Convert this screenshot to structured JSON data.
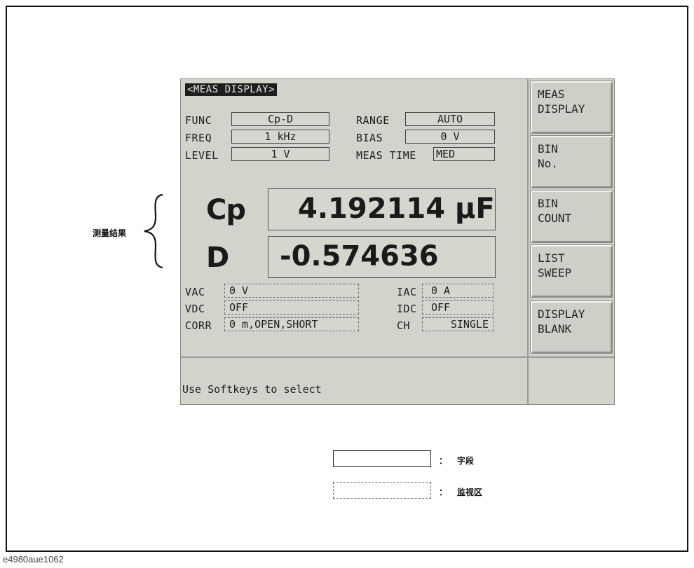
{
  "screen": {
    "title": "<MEAS DISPLAY>",
    "settings": {
      "func_label": "FUNC",
      "func_value": "Cp-D",
      "freq_label": "FREQ",
      "freq_value": "1 kHz",
      "level_label": "LEVEL",
      "level_value": "1 V",
      "range_label": "RANGE",
      "range_value": "AUTO",
      "bias_label": "BIAS",
      "bias_value": "0 V",
      "meastime_label": "MEAS TIME",
      "meastime_value": "MED"
    },
    "results": {
      "primary_param": "Cp",
      "primary_value": "4.192114 µF",
      "secondary_param": "D",
      "secondary_value": "-0.574636"
    },
    "monitors": {
      "vac_label": "VAC",
      "vac_value": "0 V",
      "vdc_label": "VDC",
      "vdc_value": "OFF",
      "corr_label": "CORR",
      "corr_value": "0 m,OPEN,SHORT",
      "iac_label": "IAC",
      "iac_value": "0 A",
      "idc_label": "IDC",
      "idc_value": "OFF",
      "ch_label": "CH",
      "ch_value": "SINGLE"
    },
    "status_message": "Use Softkeys to select",
    "softkeys": [
      "MEAS\nDISPLAY",
      "BIN\nNo.",
      "BIN\nCOUNT",
      "LIST\nSWEEP",
      "DISPLAY\nBLANK"
    ]
  },
  "annotations": {
    "results_label": "测量结果",
    "legend_field": "字段",
    "legend_monitor": "监视区",
    "legend_colon": "："
  },
  "caption": "e4980aue1062"
}
